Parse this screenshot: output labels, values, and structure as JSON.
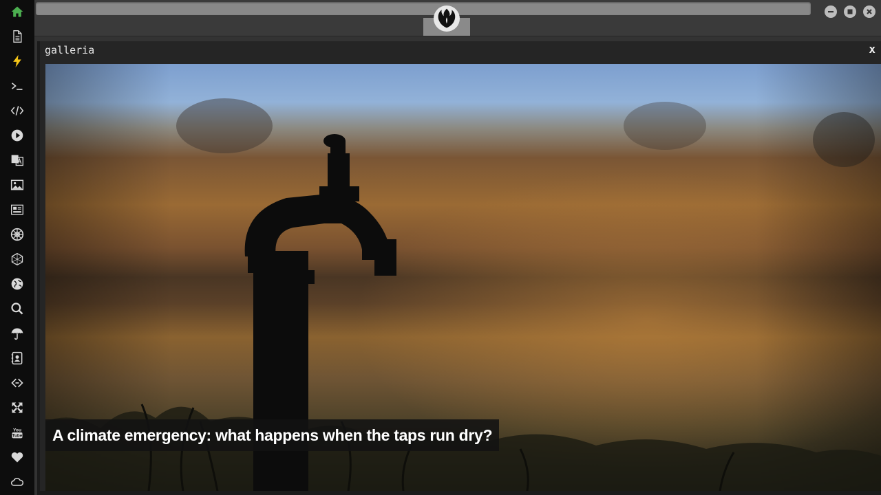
{
  "sidebar": {
    "items": [
      {
        "icon": "home-icon"
      },
      {
        "icon": "document-icon"
      },
      {
        "icon": "lightning-icon"
      },
      {
        "icon": "terminal-icon"
      },
      {
        "icon": "code-icon"
      },
      {
        "icon": "play-icon"
      },
      {
        "icon": "translate-icon"
      },
      {
        "icon": "image-icon"
      },
      {
        "icon": "news-icon"
      },
      {
        "icon": "galactic-empire-icon"
      },
      {
        "icon": "hexagon-icon"
      },
      {
        "icon": "globe-icon"
      },
      {
        "icon": "search-icon"
      },
      {
        "icon": "umbrella-icon"
      },
      {
        "icon": "address-book-icon"
      },
      {
        "icon": "chain-link-icon"
      },
      {
        "icon": "expand-icon"
      },
      {
        "icon": "youtube-icon"
      },
      {
        "icon": "heart-icon"
      },
      {
        "icon": "cloud-icon"
      }
    ],
    "active_color": "#4caf50",
    "lightning_color": "#f5c518",
    "icon_color": "#d9d9d9"
  },
  "topbar": {
    "logo_icon": "rebel-alliance-icon",
    "window_controls": [
      "minimize-icon",
      "maximize-icon",
      "close-icon"
    ]
  },
  "window": {
    "title": "galleria",
    "close_label": "x",
    "caption": "A climate emergency: what happens when the taps run dry?"
  }
}
